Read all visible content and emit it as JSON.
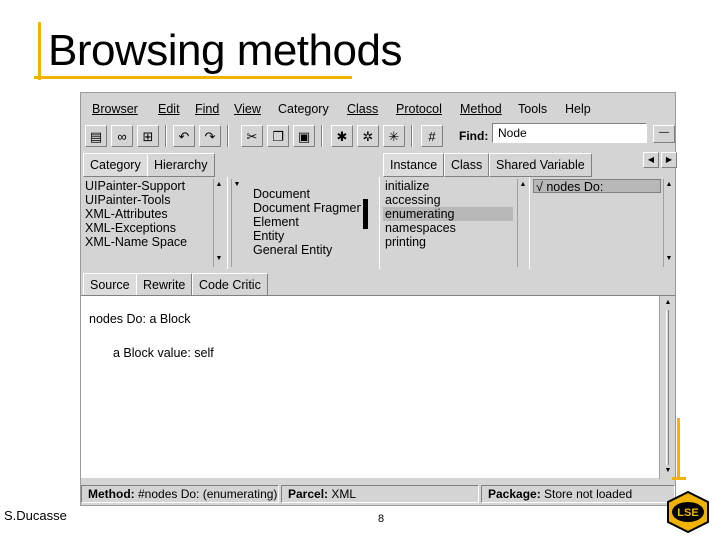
{
  "slide": {
    "title": "Browsing methods",
    "author": "S.Ducasse",
    "page_number": "8",
    "accent_color": "#f0b400",
    "logo_text": "LSE"
  },
  "menubar": {
    "items": [
      "Browser",
      "Edit",
      "Find",
      "View",
      "Category",
      "Class",
      "Protocol",
      "Method",
      "Tools",
      "Help"
    ]
  },
  "toolbar": {
    "icons": [
      "browser-icon",
      "binoculars-icon",
      "hierarchy-icon",
      "undo-icon",
      "redo-icon",
      "cut-icon",
      "copy-icon",
      "paste-icon",
      "find-senders-icon",
      "find-implementors-icon",
      "find-references-icon",
      "run-icon"
    ],
    "find_label": "Find:",
    "find_value": "Node"
  },
  "top_tabs": {
    "left": [
      "Category",
      "Hierarchy"
    ],
    "right": [
      "Instance",
      "Class",
      "Shared Variable"
    ]
  },
  "panes": {
    "categories": [
      "UIPainter-Support",
      "UIPainter-Tools",
      "XML-Attributes",
      "XML-Exceptions",
      "XML-Name Space"
    ],
    "classes": [
      "Document",
      "Document Fragment",
      "Element",
      "Entity",
      "General Entity"
    ],
    "protocols": [
      "initialize",
      "accessing",
      "enumerating",
      "namespaces",
      "printing"
    ],
    "selected_protocol": "enumerating",
    "methods": [
      "nodes Do:"
    ],
    "method_marker": "√"
  },
  "code_tabs": [
    "Source",
    "Rewrite",
    "Code Critic"
  ],
  "code": {
    "signature": "nodes Do: a Block",
    "body": "a Block value: self"
  },
  "statusbar": {
    "method_label": "Method:",
    "method_value": "#nodes Do: (enumerating)",
    "parcel_label": "Parcel:",
    "parcel_value": "XML",
    "package_label": "Package:",
    "package_value": "Store not loaded"
  }
}
